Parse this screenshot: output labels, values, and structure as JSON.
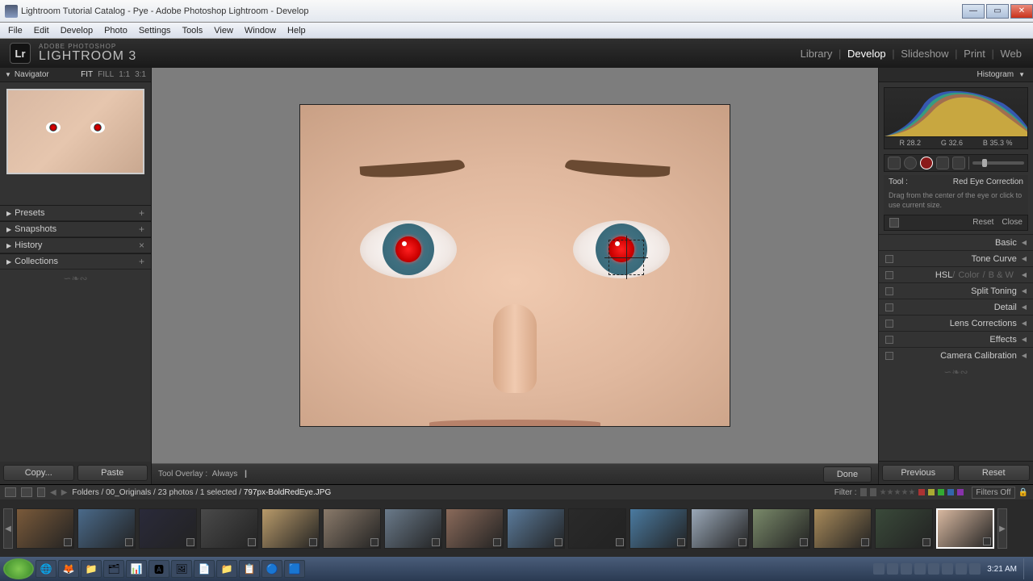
{
  "window": {
    "title": "Lightroom Tutorial Catalog - Pye - Adobe Photoshop Lightroom - Develop"
  },
  "menu": [
    "File",
    "Edit",
    "Develop",
    "Photo",
    "Settings",
    "Tools",
    "View",
    "Window",
    "Help"
  ],
  "brand": {
    "small": "ADOBE PHOTOSHOP",
    "big": "LIGHTROOM 3",
    "logo": "Lr"
  },
  "modules": {
    "items": [
      "Library",
      "Develop",
      "Slideshow",
      "Print",
      "Web"
    ],
    "active": "Develop"
  },
  "navigator": {
    "title": "Navigator",
    "zoom": [
      "FIT",
      "FILL",
      "1:1",
      "3:1"
    ],
    "zoom_active": "FIT"
  },
  "left_sections": [
    {
      "label": "Presets",
      "icon": "+"
    },
    {
      "label": "Snapshots",
      "icon": "+"
    },
    {
      "label": "History",
      "icon": "×"
    },
    {
      "label": "Collections",
      "icon": "+"
    }
  ],
  "left_buttons": {
    "copy": "Copy...",
    "paste": "Paste"
  },
  "toolbar_overlay": {
    "label": "Tool Overlay :",
    "value": "Always"
  },
  "done": "Done",
  "right_buttons": {
    "previous": "Previous",
    "reset": "Reset"
  },
  "histogram": {
    "title": "Histogram",
    "readout": {
      "r_label": "R",
      "r": "28.2",
      "g_label": "G",
      "g": "32.6",
      "b_label": "B",
      "b": "35.3",
      "pct": "%"
    }
  },
  "tool": {
    "label": "Tool :",
    "name": "Red Eye Correction",
    "hint": "Drag from the center of the eye or click to use current size.",
    "reset": "Reset",
    "close": "Close"
  },
  "right_sections": [
    {
      "label": "Basic",
      "sw": true
    },
    {
      "label": "Tone Curve",
      "sw": true
    },
    {
      "label": "HSL",
      "extra": [
        "Color",
        "B & W"
      ],
      "sw": true
    },
    {
      "label": "Split Toning",
      "sw": true
    },
    {
      "label": "Detail",
      "sw": true
    },
    {
      "label": "Lens Corrections",
      "sw": true
    },
    {
      "label": "Effects",
      "sw": true
    },
    {
      "label": "Camera Calibration",
      "sw": true
    }
  ],
  "filmstrip": {
    "path_prefix": "Folders",
    "path": "00_Originals",
    "count": "23 photos",
    "sel": "1 selected",
    "file": "797px-BoldRedEye.JPG",
    "filter_label": "Filter :",
    "filters_off": "Filters Off",
    "thumb_count": 16,
    "selected_index": 15
  },
  "taskbar": {
    "icons": [
      "🌐",
      "🦊",
      "📁",
      "🗂",
      "📊",
      "🅰",
      "🖼",
      "📄",
      "📁",
      "📋",
      "🔵",
      "🟦"
    ],
    "time": "3:21 AM"
  }
}
